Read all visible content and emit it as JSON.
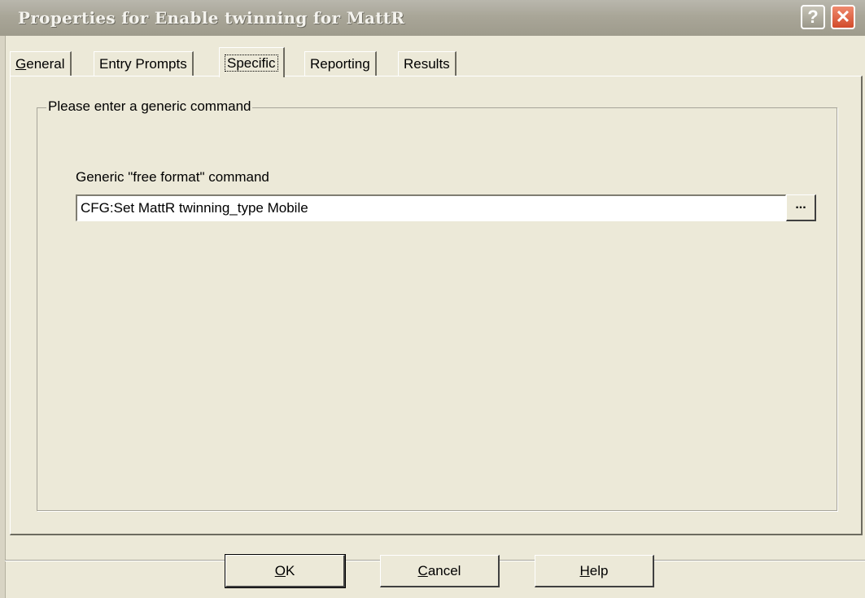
{
  "window": {
    "title": "Properties for Enable twinning for MattR",
    "help_glyph": "?",
    "close_glyph": "✕"
  },
  "tabs": [
    {
      "key": "G",
      "rest": "eneral",
      "selected": false
    },
    {
      "label": "Entry Prompts",
      "selected": false
    },
    {
      "label": "Specific",
      "selected": true
    },
    {
      "label": "Reporting",
      "selected": false
    },
    {
      "label": "Results",
      "selected": false
    }
  ],
  "group": {
    "legend": "Please enter a generic command",
    "field_label": "Generic \"free format\" command",
    "field_value": "CFG:Set MattR twinning_type Mobile",
    "browse_label": "..."
  },
  "buttons": {
    "ok": {
      "key": "O",
      "rest": "K"
    },
    "cancel": {
      "key": "C",
      "rest": "ancel"
    },
    "help": {
      "key": "H",
      "rest": "elp"
    }
  },
  "icons": {
    "help": "question-mark-icon",
    "close": "close-x-icon"
  },
  "colors": {
    "face": "#ece9d8",
    "titlebar": "#a9a698",
    "close": "#d24a2a"
  }
}
